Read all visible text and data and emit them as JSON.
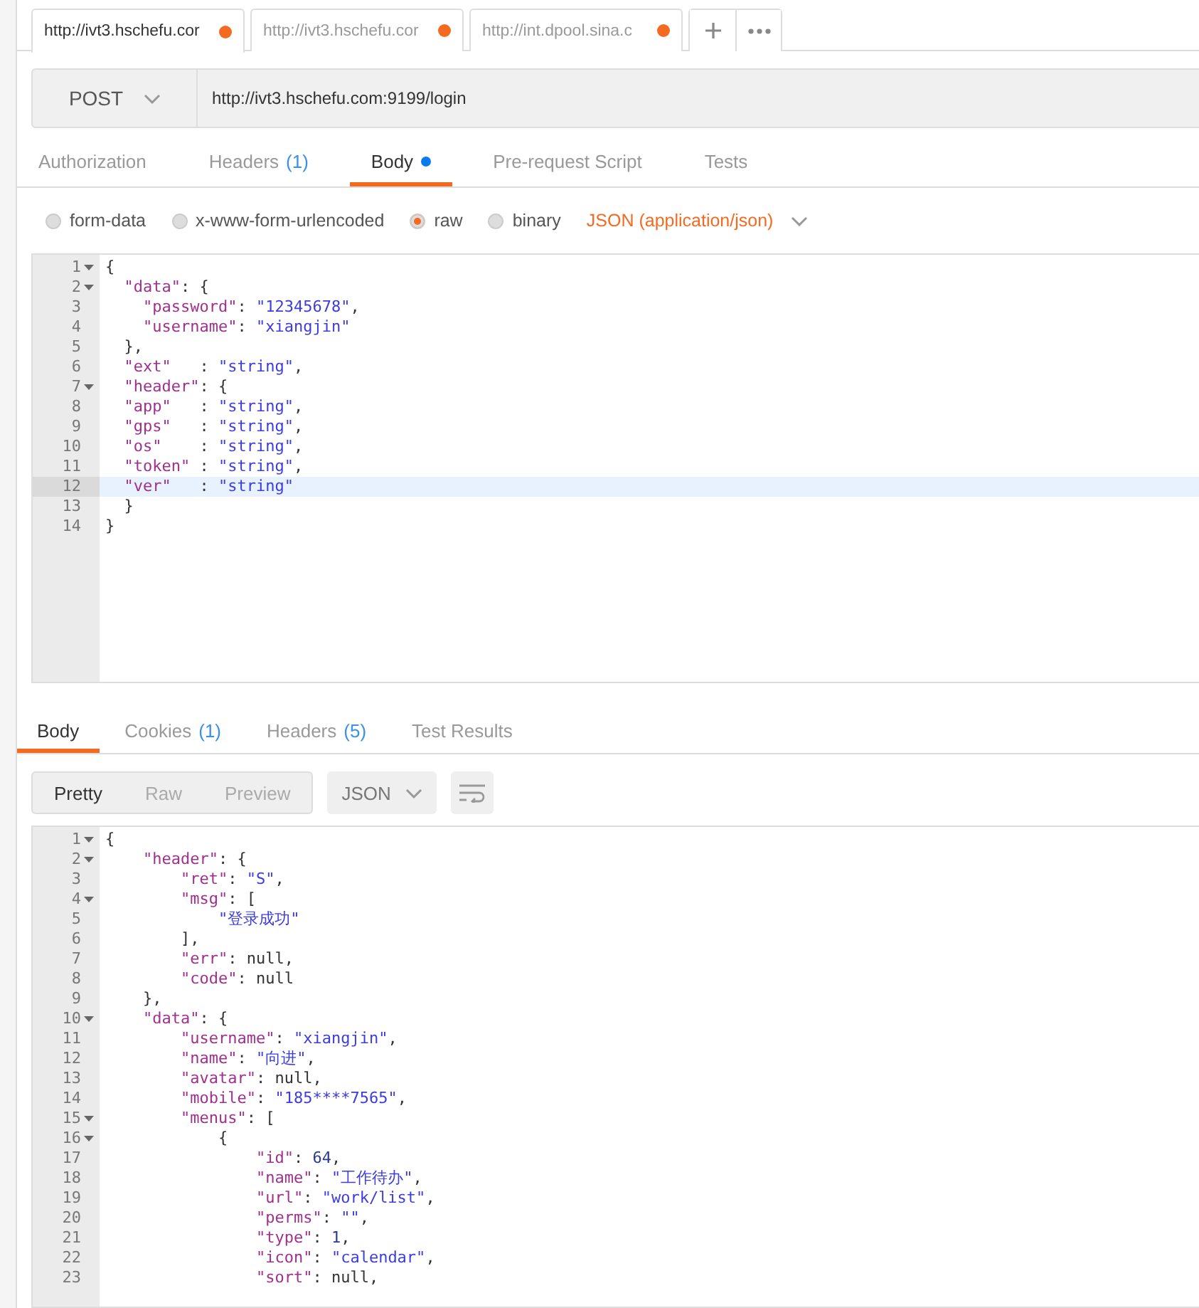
{
  "tabs": [
    {
      "label": "http://ivt3.hschefu.cor",
      "selected": true,
      "unsaved": true
    },
    {
      "label": "http://ivt3.hschefu.cor",
      "selected": false,
      "unsaved": true
    },
    {
      "label": "http://int.dpool.sina.c",
      "selected": false,
      "unsaved": true
    }
  ],
  "request": {
    "method": "POST",
    "url": "http://ivt3.hschefu.com:9199/login"
  },
  "request_tabs": [
    {
      "label": "Authorization",
      "selected": false
    },
    {
      "label": "Headers",
      "count": "(1)",
      "selected": false
    },
    {
      "label": "Body",
      "selected": true,
      "modified": true
    },
    {
      "label": "Pre-request Script",
      "selected": false
    },
    {
      "label": "Tests",
      "selected": false
    }
  ],
  "body_modes": [
    {
      "label": "form-data",
      "selected": false
    },
    {
      "label": "x-www-form-urlencoded",
      "selected": false
    },
    {
      "label": "raw",
      "selected": true
    },
    {
      "label": "binary",
      "selected": false
    }
  ],
  "body_type": "JSON (application/json)",
  "request_body": [
    {
      "number": "1",
      "foldable": true,
      "active": false,
      "tokens": [
        {
          "kind": "plain",
          "text": "{"
        }
      ]
    },
    {
      "number": "2",
      "foldable": true,
      "active": false,
      "tokens": [
        {
          "kind": "key",
          "text": "  \"data\""
        },
        {
          "kind": "plain",
          "text": ": {"
        }
      ]
    },
    {
      "number": "3",
      "foldable": false,
      "active": false,
      "tokens": [
        {
          "kind": "key",
          "text": "    \"password\""
        },
        {
          "kind": "plain",
          "text": ": "
        },
        {
          "kind": "string",
          "text": "\"12345678\""
        },
        {
          "kind": "plain",
          "text": ","
        }
      ]
    },
    {
      "number": "4",
      "foldable": false,
      "active": false,
      "tokens": [
        {
          "kind": "key",
          "text": "    \"username\""
        },
        {
          "kind": "plain",
          "text": ": "
        },
        {
          "kind": "string",
          "text": "\"xiangjin\""
        }
      ]
    },
    {
      "number": "5",
      "foldable": false,
      "active": false,
      "tokens": [
        {
          "kind": "plain",
          "text": "  },"
        }
      ]
    },
    {
      "number": "6",
      "foldable": false,
      "active": false,
      "tokens": [
        {
          "kind": "key",
          "text": "  \"ext\""
        },
        {
          "kind": "plain",
          "text": "   : "
        },
        {
          "kind": "string",
          "text": "\"string\""
        },
        {
          "kind": "plain",
          "text": ","
        }
      ]
    },
    {
      "number": "7",
      "foldable": true,
      "active": false,
      "tokens": [
        {
          "kind": "key",
          "text": "  \"header\""
        },
        {
          "kind": "plain",
          "text": ": {"
        }
      ]
    },
    {
      "number": "8",
      "foldable": false,
      "active": false,
      "tokens": [
        {
          "kind": "key",
          "text": "  \"app\""
        },
        {
          "kind": "plain",
          "text": "   : "
        },
        {
          "kind": "string",
          "text": "\"string\""
        },
        {
          "kind": "plain",
          "text": ","
        }
      ]
    },
    {
      "number": "9",
      "foldable": false,
      "active": false,
      "tokens": [
        {
          "kind": "key",
          "text": "  \"gps\""
        },
        {
          "kind": "plain",
          "text": "   : "
        },
        {
          "kind": "string",
          "text": "\"string\""
        },
        {
          "kind": "plain",
          "text": ","
        }
      ]
    },
    {
      "number": "10",
      "foldable": false,
      "active": false,
      "tokens": [
        {
          "kind": "key",
          "text": "  \"os\""
        },
        {
          "kind": "plain",
          "text": "    : "
        },
        {
          "kind": "string",
          "text": "\"string\""
        },
        {
          "kind": "plain",
          "text": ","
        }
      ]
    },
    {
      "number": "11",
      "foldable": false,
      "active": false,
      "tokens": [
        {
          "kind": "key",
          "text": "  \"token\""
        },
        {
          "kind": "plain",
          "text": " : "
        },
        {
          "kind": "string",
          "text": "\"string\""
        },
        {
          "kind": "plain",
          "text": ","
        }
      ]
    },
    {
      "number": "12",
      "foldable": false,
      "active": true,
      "tokens": [
        {
          "kind": "key",
          "text": "  \"ver\""
        },
        {
          "kind": "plain",
          "text": "   : "
        },
        {
          "kind": "string",
          "text": "\"string\""
        }
      ]
    },
    {
      "number": "13",
      "foldable": false,
      "active": false,
      "tokens": [
        {
          "kind": "plain",
          "text": "  }"
        }
      ]
    },
    {
      "number": "14",
      "foldable": false,
      "active": false,
      "tokens": [
        {
          "kind": "plain",
          "text": "}"
        }
      ]
    }
  ],
  "response_tabs": [
    {
      "label": "Body",
      "selected": true
    },
    {
      "label": "Cookies",
      "count": "(1)",
      "selected": false
    },
    {
      "label": "Headers",
      "count": "(5)",
      "selected": false
    },
    {
      "label": "Test Results",
      "selected": false
    }
  ],
  "view_modes": [
    {
      "label": "Pretty",
      "selected": true
    },
    {
      "label": "Raw",
      "selected": false
    },
    {
      "label": "Preview",
      "selected": false
    }
  ],
  "format": "JSON",
  "response_body": [
    {
      "number": "1",
      "foldable": true,
      "active": false,
      "tokens": [
        {
          "kind": "plain",
          "text": "{"
        }
      ]
    },
    {
      "number": "2",
      "foldable": true,
      "active": false,
      "tokens": [
        {
          "kind": "key",
          "text": "    \"header\""
        },
        {
          "kind": "plain",
          "text": ": {"
        }
      ]
    },
    {
      "number": "3",
      "foldable": false,
      "active": false,
      "tokens": [
        {
          "kind": "key",
          "text": "        \"ret\""
        },
        {
          "kind": "plain",
          "text": ": "
        },
        {
          "kind": "string",
          "text": "\"S\""
        },
        {
          "kind": "plain",
          "text": ","
        }
      ]
    },
    {
      "number": "4",
      "foldable": true,
      "active": false,
      "tokens": [
        {
          "kind": "key",
          "text": "        \"msg\""
        },
        {
          "kind": "plain",
          "text": ": ["
        }
      ]
    },
    {
      "number": "5",
      "foldable": false,
      "active": false,
      "tokens": [
        {
          "kind": "string",
          "text": "            \"登录成功\""
        }
      ]
    },
    {
      "number": "6",
      "foldable": false,
      "active": false,
      "tokens": [
        {
          "kind": "plain",
          "text": "        ],"
        }
      ]
    },
    {
      "number": "7",
      "foldable": false,
      "active": false,
      "tokens": [
        {
          "kind": "key",
          "text": "        \"err\""
        },
        {
          "kind": "plain",
          "text": ": null,"
        }
      ]
    },
    {
      "number": "8",
      "foldable": false,
      "active": false,
      "tokens": [
        {
          "kind": "key",
          "text": "        \"code\""
        },
        {
          "kind": "plain",
          "text": ": null"
        }
      ]
    },
    {
      "number": "9",
      "foldable": false,
      "active": false,
      "tokens": [
        {
          "kind": "plain",
          "text": "    },"
        }
      ]
    },
    {
      "number": "10",
      "foldable": true,
      "active": false,
      "tokens": [
        {
          "kind": "key",
          "text": "    \"data\""
        },
        {
          "kind": "plain",
          "text": ": {"
        }
      ]
    },
    {
      "number": "11",
      "foldable": false,
      "active": false,
      "tokens": [
        {
          "kind": "key",
          "text": "        \"username\""
        },
        {
          "kind": "plain",
          "text": ": "
        },
        {
          "kind": "string",
          "text": "\"xiangjin\""
        },
        {
          "kind": "plain",
          "text": ","
        }
      ]
    },
    {
      "number": "12",
      "foldable": false,
      "active": false,
      "tokens": [
        {
          "kind": "key",
          "text": "        \"name\""
        },
        {
          "kind": "plain",
          "text": ": "
        },
        {
          "kind": "string",
          "text": "\"向进\""
        },
        {
          "kind": "plain",
          "text": ","
        }
      ]
    },
    {
      "number": "13",
      "foldable": false,
      "active": false,
      "tokens": [
        {
          "kind": "key",
          "text": "        \"avatar\""
        },
        {
          "kind": "plain",
          "text": ": null,"
        }
      ]
    },
    {
      "number": "14",
      "foldable": false,
      "active": false,
      "tokens": [
        {
          "kind": "key",
          "text": "        \"mobile\""
        },
        {
          "kind": "plain",
          "text": ": "
        },
        {
          "kind": "string",
          "text": "\"185****7565\""
        },
        {
          "kind": "plain",
          "text": ","
        }
      ]
    },
    {
      "number": "15",
      "foldable": true,
      "active": false,
      "tokens": [
        {
          "kind": "key",
          "text": "        \"menus\""
        },
        {
          "kind": "plain",
          "text": ": ["
        }
      ]
    },
    {
      "number": "16",
      "foldable": true,
      "active": false,
      "tokens": [
        {
          "kind": "plain",
          "text": "            {"
        }
      ]
    },
    {
      "number": "17",
      "foldable": false,
      "active": false,
      "tokens": [
        {
          "kind": "key",
          "text": "                \"id\""
        },
        {
          "kind": "plain",
          "text": ": "
        },
        {
          "kind": "number",
          "text": "64"
        },
        {
          "kind": "plain",
          "text": ","
        }
      ]
    },
    {
      "number": "18",
      "foldable": false,
      "active": false,
      "tokens": [
        {
          "kind": "key",
          "text": "                \"name\""
        },
        {
          "kind": "plain",
          "text": ": "
        },
        {
          "kind": "string",
          "text": "\"工作待办\""
        },
        {
          "kind": "plain",
          "text": ","
        }
      ]
    },
    {
      "number": "19",
      "foldable": false,
      "active": false,
      "tokens": [
        {
          "kind": "key",
          "text": "                \"url\""
        },
        {
          "kind": "plain",
          "text": ": "
        },
        {
          "kind": "string",
          "text": "\"work/list\""
        },
        {
          "kind": "plain",
          "text": ","
        }
      ]
    },
    {
      "number": "20",
      "foldable": false,
      "active": false,
      "tokens": [
        {
          "kind": "key",
          "text": "                \"perms\""
        },
        {
          "kind": "plain",
          "text": ": "
        },
        {
          "kind": "string",
          "text": "\"\""
        },
        {
          "kind": "plain",
          "text": ","
        }
      ]
    },
    {
      "number": "21",
      "foldable": false,
      "active": false,
      "tokens": [
        {
          "kind": "key",
          "text": "                \"type\""
        },
        {
          "kind": "plain",
          "text": ": "
        },
        {
          "kind": "number",
          "text": "1"
        },
        {
          "kind": "plain",
          "text": ","
        }
      ]
    },
    {
      "number": "22",
      "foldable": false,
      "active": false,
      "tokens": [
        {
          "kind": "key",
          "text": "                \"icon\""
        },
        {
          "kind": "plain",
          "text": ": "
        },
        {
          "kind": "string",
          "text": "\"calendar\""
        },
        {
          "kind": "plain",
          "text": ","
        }
      ]
    },
    {
      "number": "23",
      "foldable": false,
      "active": false,
      "tokens": [
        {
          "kind": "key",
          "text": "                \"sort\""
        },
        {
          "kind": "plain",
          "text": ": null,"
        }
      ]
    }
  ]
}
